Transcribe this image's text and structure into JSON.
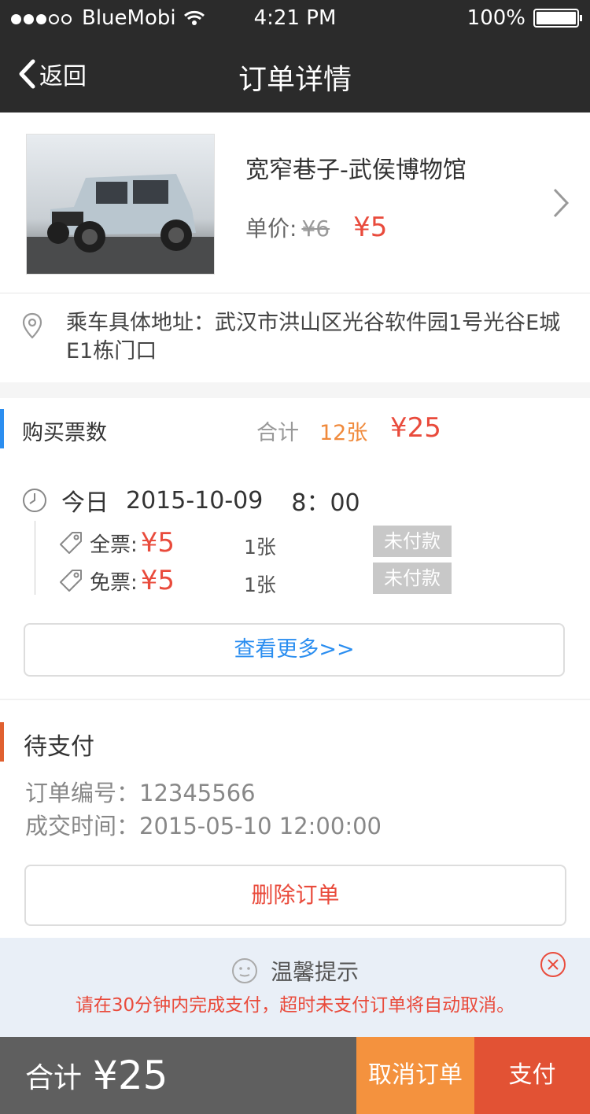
{
  "status_bar": {
    "carrier": "BlueMobi",
    "time": "4:21 PM",
    "battery": "100%"
  },
  "nav": {
    "back_label": "返回",
    "title": "订单详情"
  },
  "product": {
    "name": "宽窄巷子-武侯博物馆",
    "price_label": "单价:",
    "original_price": "¥6",
    "price": "¥5"
  },
  "address": {
    "text": "乘车具体地址：武汉市洪山区光谷软件园1号光谷E城 E1栋门口"
  },
  "tickets": {
    "label": "购买票数",
    "sum_label": "合计",
    "count": "12张",
    "total": "¥25",
    "date_label": "今日",
    "date": "2015-10-09",
    "time": "8：00",
    "rows": [
      {
        "type": "全票:",
        "price": "¥5",
        "qty": "1张",
        "status": "未付款"
      },
      {
        "type": "免票:",
        "price": "¥5",
        "qty": "1张",
        "status": "未付款"
      }
    ],
    "more_label": "查看更多>>"
  },
  "order": {
    "status": "待支付",
    "number_label": "订单编号：12345566",
    "time_label": "成交时间：2015-05-10  12:00:00",
    "delete_label": "删除订单"
  },
  "tip": {
    "title": "温馨提示",
    "message": "请在30分钟内完成支付，超时未支付订单将自动取消。"
  },
  "bottom": {
    "sum_label": "合计",
    "sum_value": "¥25",
    "cancel_label": "取消订单",
    "pay_label": "支付"
  },
  "colors": {
    "accent_red": "#e94b3c",
    "accent_blue": "#2b8ef0",
    "accent_orange": "#f4923e",
    "header": "#2b2b2b"
  }
}
